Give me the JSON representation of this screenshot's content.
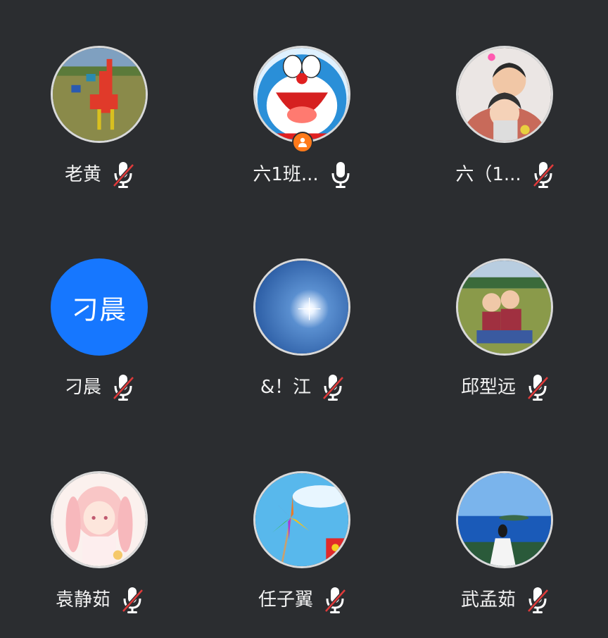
{
  "participants": [
    {
      "name": "老黄",
      "mic": "muted",
      "avatar": "photo-deer-sculpture"
    },
    {
      "name": "六1班...",
      "mic": "on",
      "avatar": "photo-doraemon",
      "role": "host"
    },
    {
      "name": "六（1...",
      "mic": "muted",
      "avatar": "photo-two-kids"
    },
    {
      "name": "刁晨",
      "mic": "muted",
      "avatar_text": "刁晨",
      "avatar_color": "#1677ff"
    },
    {
      "name": "&！江",
      "mic": "muted",
      "avatar": "photo-sun-sky"
    },
    {
      "name": "邱型远",
      "mic": "muted",
      "avatar": "photo-boys-sitting"
    },
    {
      "name": "袁静茹",
      "mic": "muted",
      "avatar": "photo-anime-girl"
    },
    {
      "name": "任子翼",
      "mic": "muted",
      "avatar": "photo-pinwheel"
    },
    {
      "name": "武孟茹",
      "mic": "muted",
      "avatar": "photo-seaside-girl"
    }
  ],
  "colors": {
    "background": "#2b2d30",
    "muted_slash": "#e03a3a",
    "host_badge": "#ff7a1a",
    "avatar_border": "#d9d9d9"
  }
}
